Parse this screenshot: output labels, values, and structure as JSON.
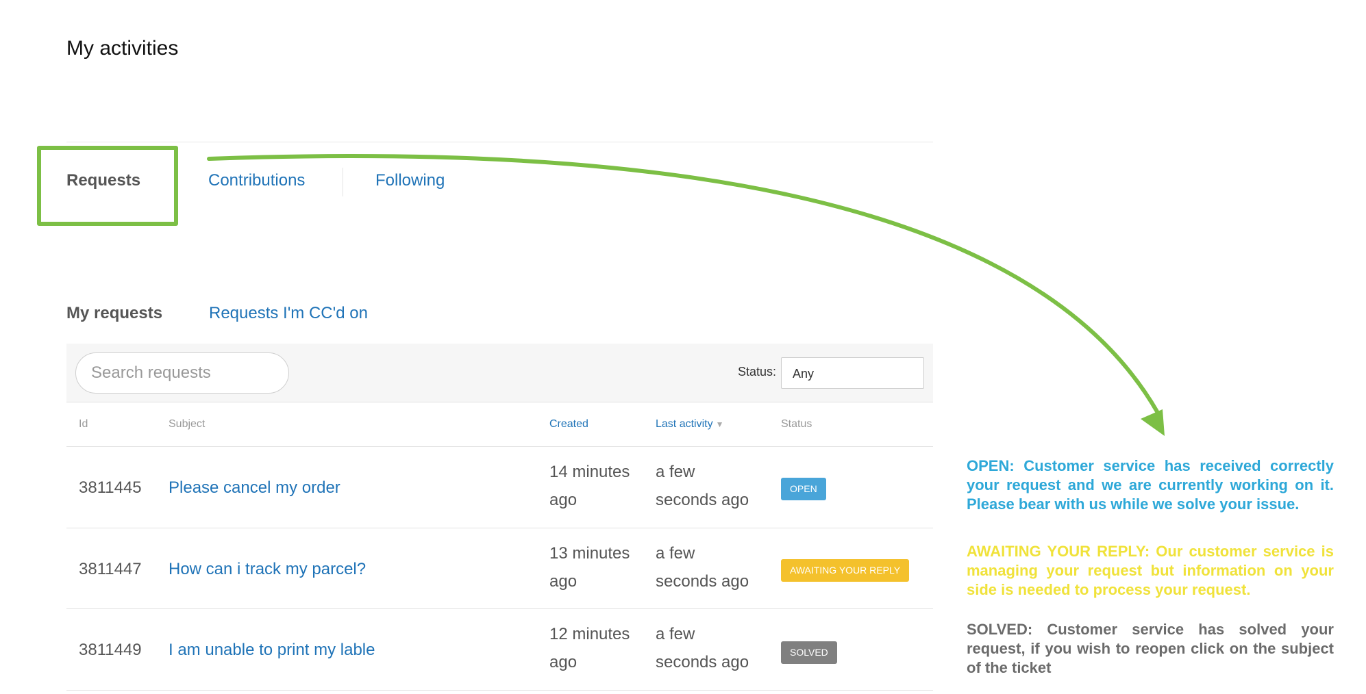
{
  "page": {
    "title": "My activities"
  },
  "main_tabs": [
    {
      "label": "Requests",
      "active": true
    },
    {
      "label": "Contributions",
      "active": false
    },
    {
      "label": "Following",
      "active": false
    }
  ],
  "sub_tabs": [
    {
      "label": "My requests",
      "active": true
    },
    {
      "label": "Requests I'm CC'd on",
      "active": false
    }
  ],
  "toolbar": {
    "search_placeholder": "Search requests",
    "status_label": "Status:",
    "status_value": "Any"
  },
  "table": {
    "headers": {
      "id": "Id",
      "subject": "Subject",
      "created": "Created",
      "last_activity": "Last activity",
      "status": "Status"
    },
    "rows": [
      {
        "id": "3811445",
        "subject": "Please cancel my order",
        "created": "14 minutes ago",
        "last_activity": "a few seconds ago",
        "status": "OPEN",
        "status_color": "#49a5d9"
      },
      {
        "id": "3811447",
        "subject": "How can i track my parcel?",
        "created": "13 minutes ago",
        "last_activity": "a few seconds ago",
        "status": "AWAITING YOUR REPLY",
        "status_color": "#f4c12c"
      },
      {
        "id": "3811449",
        "subject": "I am unable to print my lable",
        "created": "12 minutes ago",
        "last_activity": "a few seconds ago",
        "status": "SOLVED",
        "status_color": "#808080"
      }
    ]
  },
  "legend": {
    "open": {
      "text": "OPEN: Customer service has received correctly your request and we are currently working on it. Please bear with us while we solve your issue.",
      "color": "#2ea8d8"
    },
    "awaiting": {
      "text": "AWAITING YOUR REPLY: Our customer service is managing your request but information on your side is needed to process your request.",
      "color": "#f0e23a"
    },
    "solved": {
      "text": "SOLVED: Customer service has solved your request, if you wish to reopen click on the subject of the ticket",
      "color": "#6b6b6b"
    }
  },
  "annotation_color": "#7cbf45"
}
